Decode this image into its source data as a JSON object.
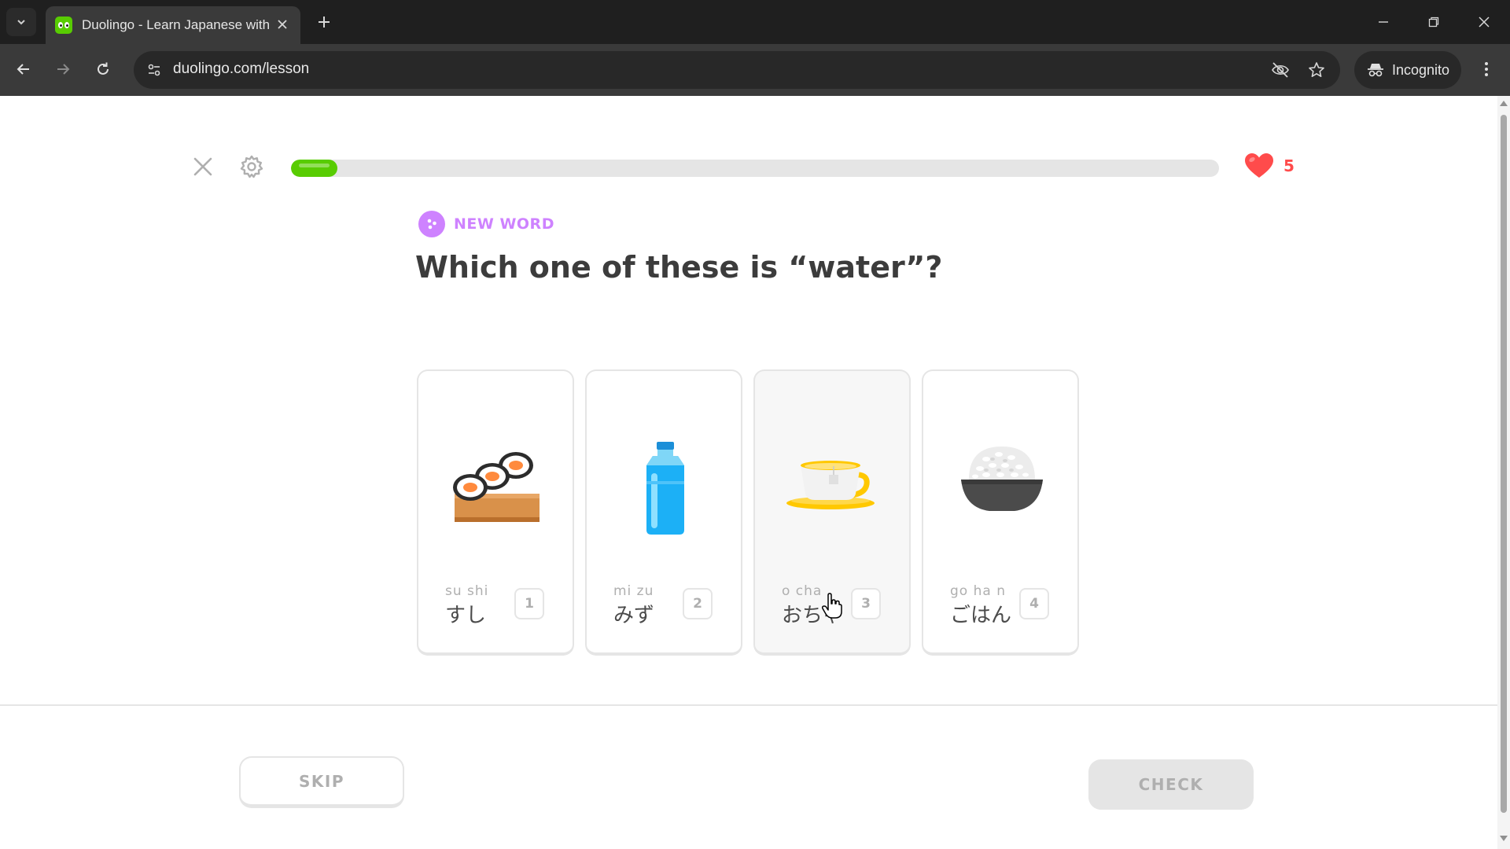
{
  "browser": {
    "tab": {
      "title": "Duolingo - Learn Japanese with",
      "favicon": "duolingo-owl-icon"
    },
    "url": "duolingo.com/lesson",
    "incognito_label": "Incognito"
  },
  "lesson": {
    "progress_percent": 5,
    "hearts": "5",
    "tag": "NEW WORD",
    "question": "Which one of these is “water”?",
    "choices": [
      {
        "romaji": "su shi",
        "kana": "すし",
        "key": "1",
        "icon": "sushi-icon"
      },
      {
        "romaji": "mi zu",
        "kana": "みず",
        "key": "2",
        "icon": "water-bottle-icon"
      },
      {
        "romaji": "o  cha",
        "kana": "おちゃ",
        "key": "3",
        "icon": "tea-cup-icon"
      },
      {
        "romaji": "go ha n",
        "kana": "ごはん",
        "key": "4",
        "icon": "rice-bowl-icon"
      }
    ],
    "skip_label": "SKIP",
    "check_label": "CHECK"
  },
  "colors": {
    "progress": "#58cc02",
    "heart": "#ff4b4b",
    "new_word": "#ce82ff",
    "question_text": "#3c3c3c"
  }
}
